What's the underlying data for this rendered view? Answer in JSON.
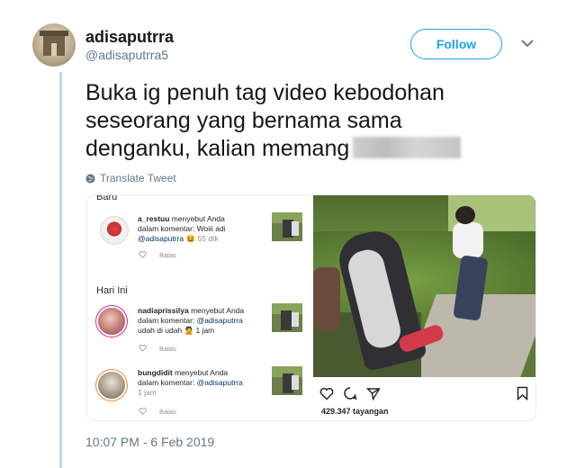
{
  "user": {
    "display_name": "adisaputrra",
    "handle": "@adisaputrra5",
    "follow_label": "Follow"
  },
  "tweet": {
    "text": "Buka ig penuh tag video kebodohan seseorang yang bernama sama denganku,  kalian memang",
    "translate_label": "Translate Tweet",
    "timestamp": "10:07 PM - 6 Feb 2019"
  },
  "instagram": {
    "top_label": "Baru",
    "today_label": "Hari Ini",
    "reply_label": "Balas",
    "notifications": [
      {
        "username": "a_restuu",
        "line1": " menyebut Anda",
        "line2": "dalam komentar: Woiii adi",
        "mention": "@adisaputrra",
        "after_mention": " 😆 55 dtk",
        "time": ""
      },
      {
        "username": "nadiaprissilya",
        "line1": " menyebut Anda",
        "line2": "dalam komentar: ",
        "mention": "@adisaputrra",
        "after_mention": "",
        "time": "udah di udah 🤦 1 jam"
      },
      {
        "username": "bungdidit",
        "line1": " menyebut Anda",
        "line2": "dalam komentar: ",
        "mention": "@adisaputrra",
        "after_mention": "",
        "time": "1 jam"
      }
    ],
    "views": "429.347 tayangan"
  },
  "colors": {
    "twitter_blue": "#1da1f2",
    "muted_text": "#657786",
    "thread_line": "#b9dcf0"
  }
}
